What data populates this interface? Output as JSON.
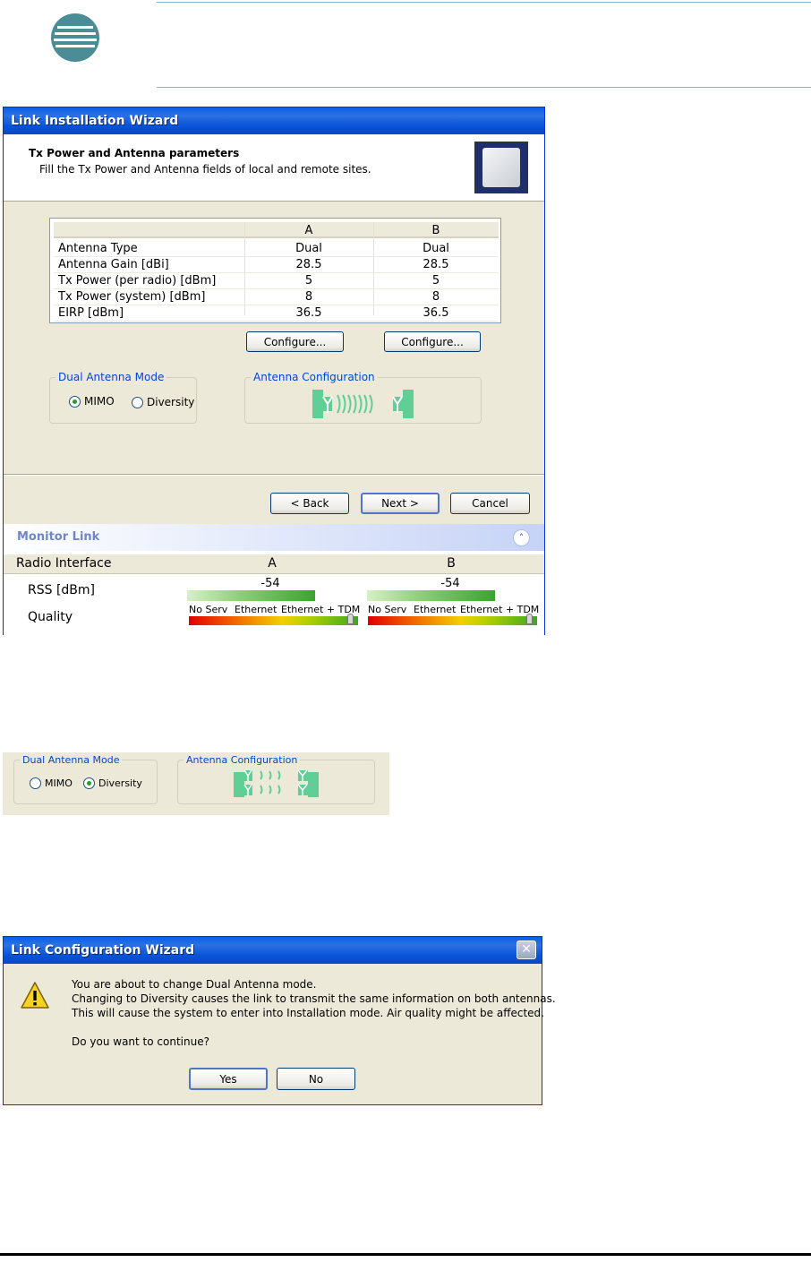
{
  "wizard1": {
    "title": "Link Installation Wizard",
    "header_title": "Tx Power and Antenna parameters",
    "header_subtitle": "Fill the Tx Power and Antenna fields of local and remote sites.",
    "table": {
      "col_a": "A",
      "col_b": "B",
      "rows": [
        {
          "label": "Antenna Type",
          "a": "Dual",
          "b": "Dual"
        },
        {
          "label": "Antenna Gain [dBi]",
          "a": "28.5",
          "b": "28.5"
        },
        {
          "label": "Tx Power (per radio) [dBm]",
          "a": "5",
          "b": "5"
        },
        {
          "label": "Tx Power (system) [dBm]",
          "a": "8",
          "b": "8"
        },
        {
          "label": "EIRP [dBm]",
          "a": "36.5",
          "b": "36.5"
        }
      ]
    },
    "configure_a": "Configure...",
    "configure_b": "Configure...",
    "dual_mode_legend": "Dual Antenna Mode",
    "mimo_label": "MIMO",
    "diversity_label": "Diversity",
    "selected_mode": "MIMO",
    "antenna_config_legend": "Antenna Configuration",
    "back_button": "< Back",
    "next_button": "Next >",
    "cancel_button": "Cancel",
    "monitor": {
      "title": "Monitor Link",
      "col_interface": "Radio Interface",
      "col_a": "A",
      "col_b": "B",
      "rss_label": "RSS [dBm]",
      "quality_label": "Quality",
      "rss_a": "-54",
      "rss_b": "-54",
      "q_noserv": "No Serv",
      "q_ethernet": "Ethernet",
      "q_ethernet_tdm": "Ethernet + TDM"
    }
  },
  "snippet": {
    "dual_mode_legend": "Dual Antenna Mode",
    "mimo_label": "MIMO",
    "diversity_label": "Diversity",
    "selected_mode": "Diversity",
    "antenna_config_legend": "Antenna Configuration"
  },
  "wizard2": {
    "title": "Link Configuration Wizard",
    "line1": "You are about to change Dual Antenna mode.",
    "line2": "Changing to Diversity causes the link to transmit the same information on both antennas.",
    "line3": "This will cause the system to enter into Installation mode. Air quality might be affected.",
    "line4": "Do you want to continue?",
    "yes_button": "Yes",
    "no_button": "No"
  },
  "colors": {
    "titlebar": "#0753d8",
    "legend_text": "#0046d5",
    "antenna_green": "#5fcf96"
  },
  "icons": [
    "logo-icon",
    "antenna-panel-icon",
    "collapse-chevron-icon",
    "warning-icon",
    "close-icon"
  ]
}
